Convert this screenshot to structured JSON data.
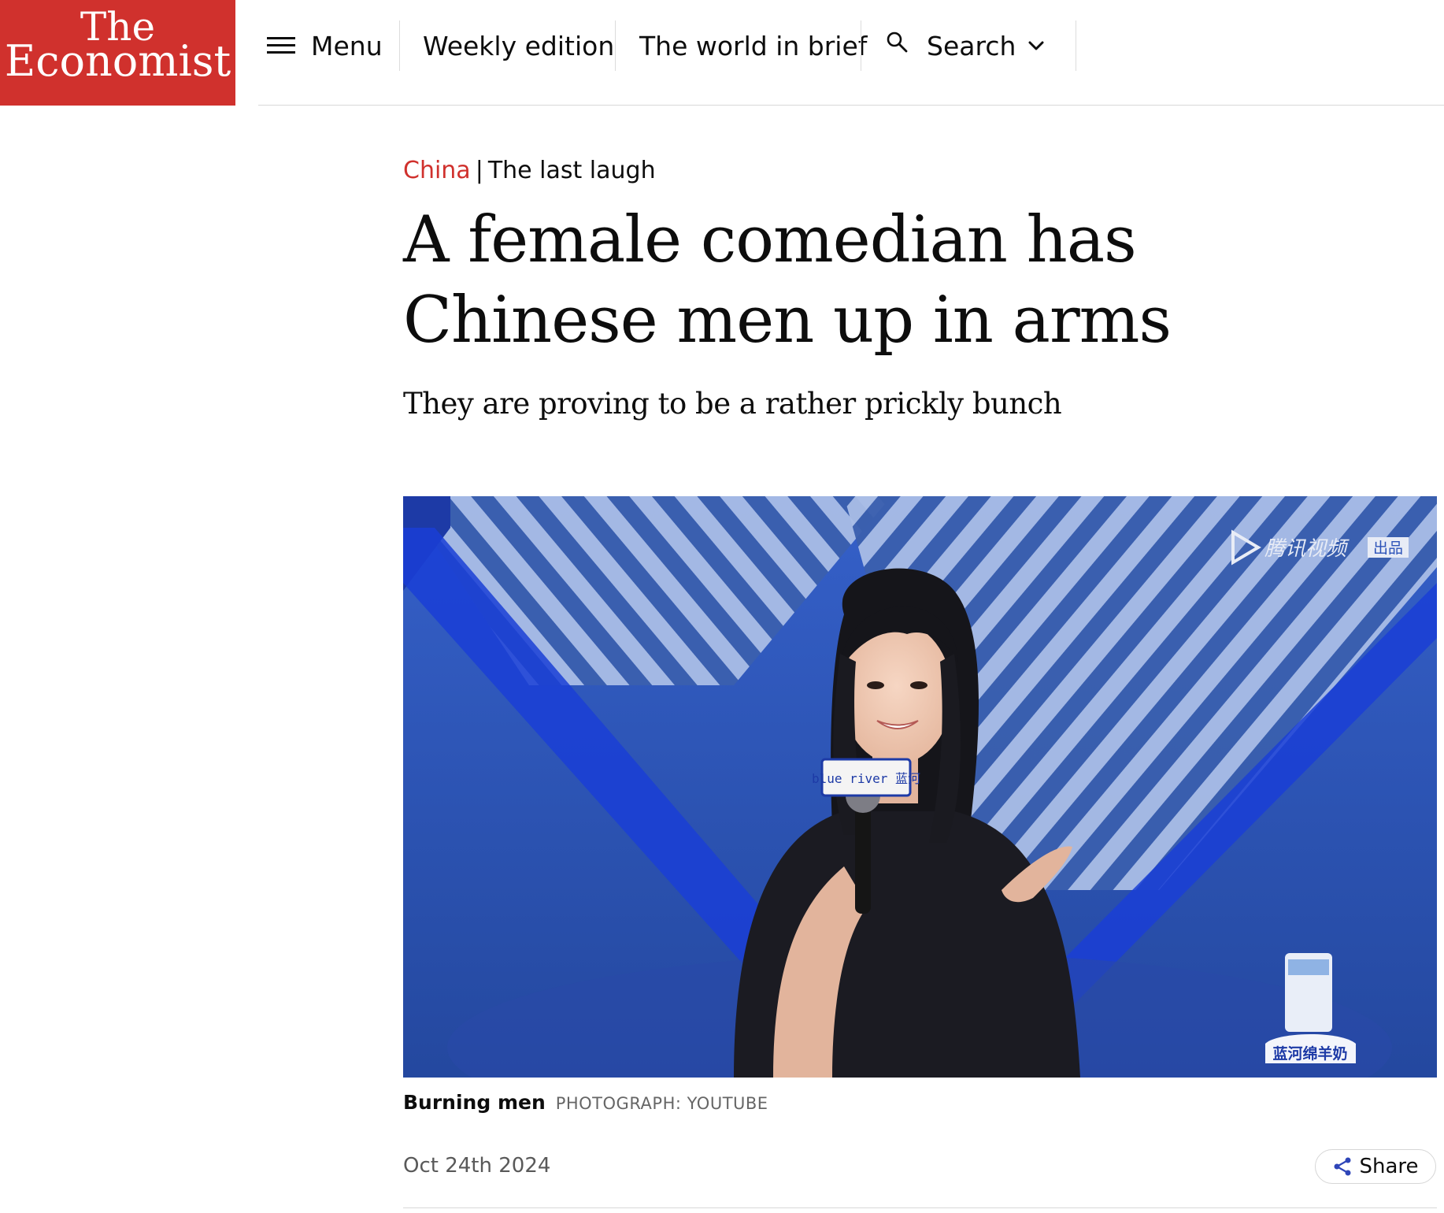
{
  "brand": {
    "line1": "The",
    "line2": "Economist",
    "color": "#d0312d"
  },
  "nav": {
    "menu_label": "Menu",
    "weekly_label": "Weekly edition",
    "brief_label": "The world in brief",
    "search_label": "Search"
  },
  "article": {
    "section": "China",
    "separator": "|",
    "rubric": "The last laugh",
    "headline": "A female comedian has Chinese men up in arms",
    "subheadline": "They are proving to be a rather prickly bunch",
    "caption_title": "Burning men",
    "caption_credit": "PHOTOGRAPH: YOUTUBE",
    "date": "Oct 24th 2024"
  },
  "photo": {
    "watermark": "腾讯视频",
    "watermark_tag": "出品",
    "mic_flag": "blue river 蓝河",
    "product_label": "蓝河绵羊奶"
  },
  "actions": {
    "share_label": "Share"
  },
  "icons": {
    "menu": "hamburger-icon",
    "search": "search-icon",
    "chevron": "chevron-down-icon",
    "share": "share-icon"
  },
  "colors": {
    "accent_red": "#d0312d",
    "text": "#0d0d0d",
    "muted": "#595959",
    "share_icon": "#2e45b8"
  }
}
